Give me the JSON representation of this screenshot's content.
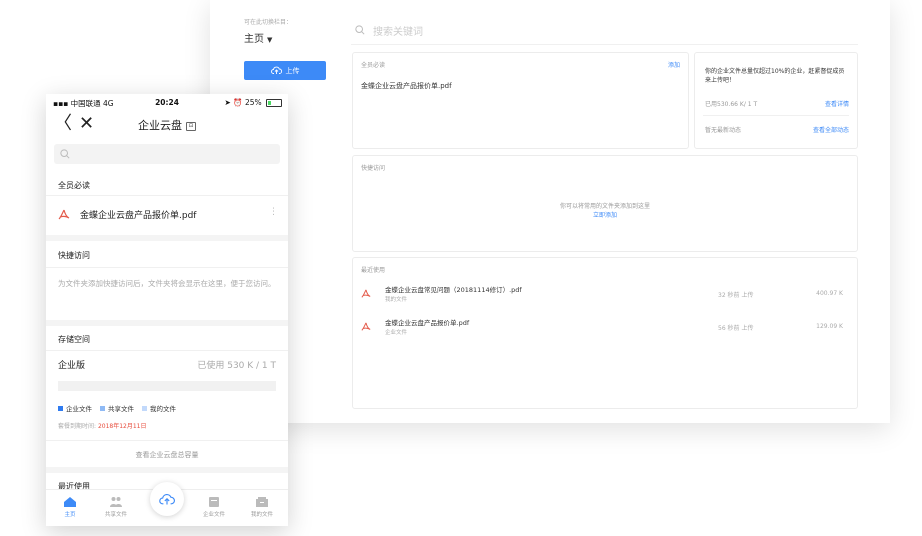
{
  "desktop": {
    "sidebar": {
      "hint": "可在此切换栏目：",
      "current": "主页",
      "upload_label": "上传"
    },
    "search_placeholder": "搜索关键词",
    "must_read": {
      "title": "全员必读",
      "add_label": "添加",
      "file": "金蝶企业云盘产品报价单.pdf"
    },
    "info": {
      "message": "你的企业文件总量仅超过10%的企业，赶紧督促成员来上传吧！",
      "used": "已用530.66 K/ 1 T",
      "details_link": "查看详情",
      "no_activity": "暂无最新动态",
      "all_activity_link": "查看全部动态"
    },
    "quick_access": {
      "title": "快捷访问",
      "empty_text": "你可以将常用的文件夹添加到这里",
      "add_link": "立即添加"
    },
    "recent": {
      "title": "最近使用",
      "items": [
        {
          "name": "金蝶企业云盘常见问题（20181114修订）.pdf",
          "location": "我的文件",
          "time": "32 秒前 上传",
          "size": "400.97 K"
        },
        {
          "name": "金蝶企业云盘产品报价单.pdf",
          "location": "企业文件",
          "time": "56 秒前 上传",
          "size": "129.09 K"
        }
      ]
    }
  },
  "mobile": {
    "status": {
      "carrier": "中国联通 4G",
      "time": "20:24",
      "battery": "25%"
    },
    "nav": {
      "back": "〈",
      "close": "✕",
      "title": "企业云盘"
    },
    "must_read": {
      "title": "全员必读",
      "file": "金蝶企业云盘产品报价单.pdf"
    },
    "quick_access": {
      "title": "快捷访问",
      "desc": "为文件夹添加快捷访问后，文件夹将会显示在这里，便于您访问。"
    },
    "storage": {
      "title": "存储空间",
      "plan": "企业版",
      "used": "已使用 530 K / 1 T",
      "used_fraction": 0.0,
      "legend": [
        "企业文件",
        "共享文件",
        "我的文件"
      ],
      "expire_label": "套餐到期时间:",
      "expire_date": "2018年12月11日",
      "view_total": "查看企业云盘总容量"
    },
    "recent_title": "最近使用",
    "tabs": [
      "主页",
      "共享文件",
      "企业文件",
      "我的文件"
    ]
  },
  "colors": {
    "accent": "#3d8af7",
    "pdf_red": "#e45b4b",
    "legend": [
      "#2f7bf0",
      "#8fbaf5",
      "#c2d9fb"
    ]
  }
}
